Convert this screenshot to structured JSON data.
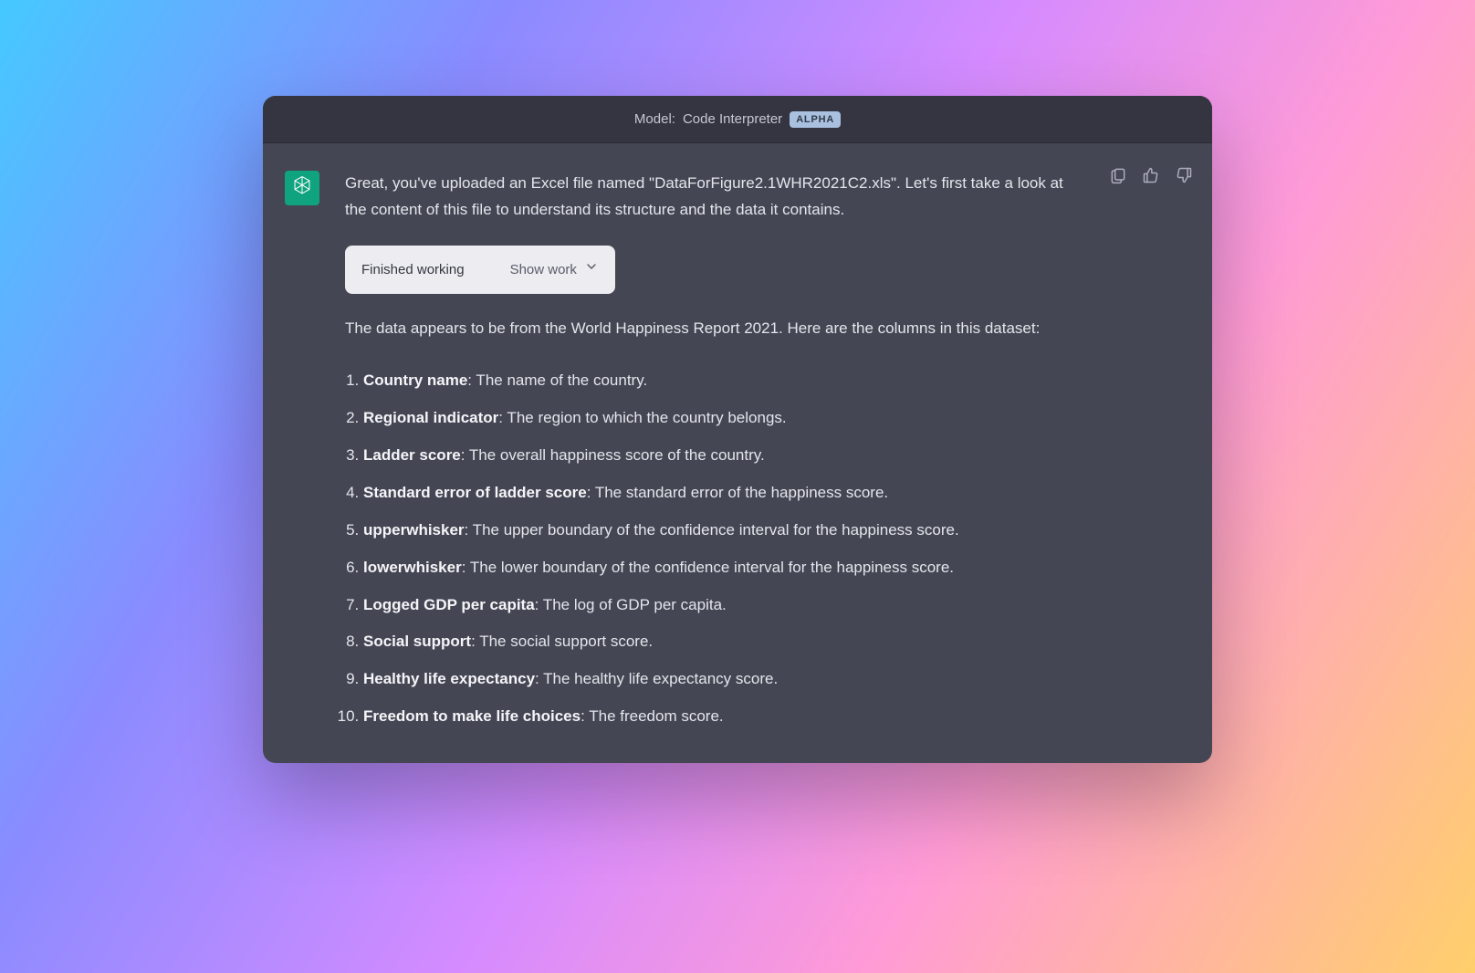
{
  "header": {
    "model_prefix": "Model: ",
    "model_name": "Code Interpreter",
    "badge": "ALPHA"
  },
  "message": {
    "intro": "Great, you've uploaded an Excel file named \"DataForFigure2.1WHR2021C2.xls\". Let's first take a look at the content of this file to understand its structure and the data it contains.",
    "work_status": "Finished working",
    "show_work_label": "Show work",
    "after_work": "The data appears to be from the World Happiness Report 2021. Here are the columns in this dataset:",
    "fields": [
      {
        "term": "Country name",
        "desc": ": The name of the country."
      },
      {
        "term": "Regional indicator",
        "desc": ": The region to which the country belongs."
      },
      {
        "term": "Ladder score",
        "desc": ": The overall happiness score of the country."
      },
      {
        "term": "Standard error of ladder score",
        "desc": ": The standard error of the happiness score."
      },
      {
        "term": "upperwhisker",
        "desc": ": The upper boundary of the confidence interval for the happiness score."
      },
      {
        "term": "lowerwhisker",
        "desc": ": The lower boundary of the confidence interval for the happiness score."
      },
      {
        "term": "Logged GDP per capita",
        "desc": ": The log of GDP per capita."
      },
      {
        "term": "Social support",
        "desc": ": The social support score."
      },
      {
        "term": "Healthy life expectancy",
        "desc": ": The healthy life expectancy score."
      },
      {
        "term": "Freedom to make life choices",
        "desc": ": The freedom score."
      }
    ]
  },
  "icons": {
    "clipboard": "clipboard-icon",
    "thumbs_up": "thumbs-up-icon",
    "thumbs_down": "thumbs-down-icon",
    "chevron_down": "chevron-down-icon",
    "assistant_logo": "assistant-logo-icon"
  }
}
